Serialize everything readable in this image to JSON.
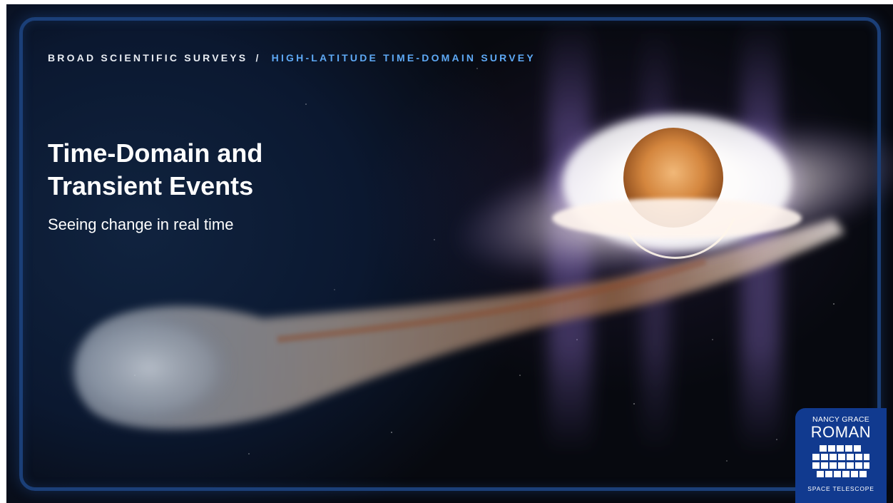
{
  "breadcrumb": {
    "parent": "BROAD SCIENTIFIC SURVEYS",
    "separator": "/",
    "current": "HIGH-LATITUDE TIME-DOMAIN SURVEY"
  },
  "hero": {
    "title_line1": "Time-Domain and",
    "title_line2": "Transient Events",
    "subtitle": "Seeing change in real time"
  },
  "logo": {
    "line1": "NANCY GRACE",
    "line2": "ROMAN",
    "line3": "SPACE TELESCOPE",
    "icon": "telescope-mirror-grid-icon"
  },
  "colors": {
    "frame": "#1b3f78",
    "breadcrumb_accent": "#5ea9f5",
    "logo_bg": "#113a8f",
    "text": "#ffffff"
  }
}
